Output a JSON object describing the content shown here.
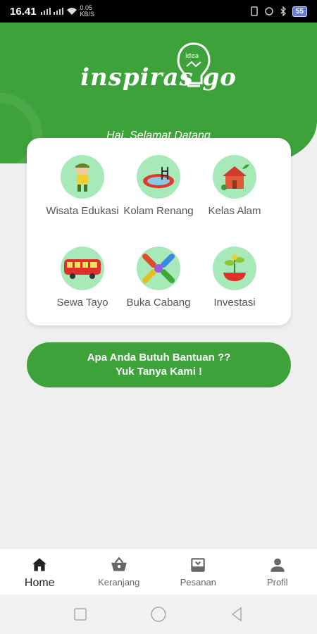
{
  "status_bar": {
    "time": "16.41",
    "network_speed": "0.05 KB/S",
    "battery": "55"
  },
  "header": {
    "logo_text": "inspiras  go",
    "bulb_text": "idea",
    "greeting": "Hai, Selamat Datang"
  },
  "menu": {
    "items": [
      {
        "label": "Wisata Edukasi",
        "icon": "child-icon"
      },
      {
        "label": "Kolam Renang",
        "icon": "pool-icon"
      },
      {
        "label": "Kelas Alam",
        "icon": "house-plant-icon"
      },
      {
        "label": "Sewa Tayo",
        "icon": "bus-icon"
      },
      {
        "label": "Buka Cabang",
        "icon": "hands-icon"
      },
      {
        "label": "Investasi",
        "icon": "money-plant-icon"
      }
    ]
  },
  "help_button": {
    "line1": "Apa Anda Butuh Bantuan ??",
    "line2": "Yuk Tanya Kami !"
  },
  "bottom_nav": {
    "items": [
      {
        "label": "Home",
        "icon": "home-icon",
        "active": true
      },
      {
        "label": "Keranjang",
        "icon": "basket-icon",
        "active": false
      },
      {
        "label": "Pesanan",
        "icon": "inbox-icon",
        "active": false
      },
      {
        "label": "Profil",
        "icon": "person-icon",
        "active": false
      }
    ]
  },
  "colors": {
    "primary": "#3da23a",
    "icon_bg": "#a7e9b8"
  }
}
